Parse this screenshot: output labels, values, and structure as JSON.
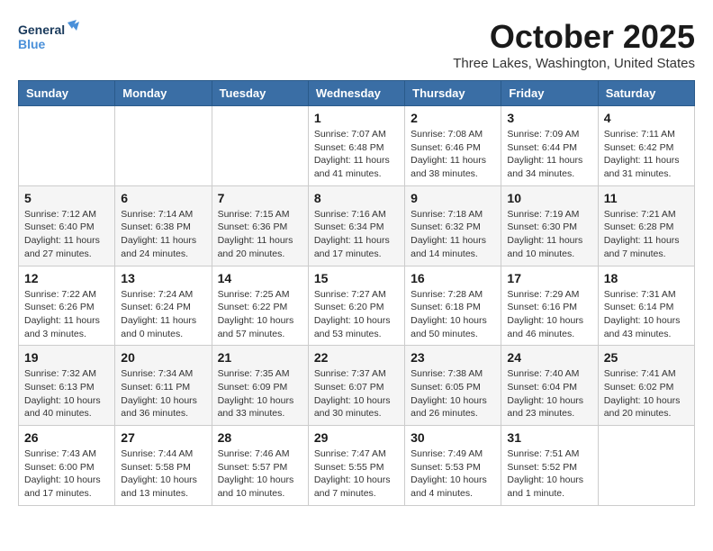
{
  "header": {
    "logo_general": "General",
    "logo_blue": "Blue",
    "month_title": "October 2025",
    "location": "Three Lakes, Washington, United States"
  },
  "weekdays": [
    "Sunday",
    "Monday",
    "Tuesday",
    "Wednesday",
    "Thursday",
    "Friday",
    "Saturday"
  ],
  "weeks": [
    [
      {
        "day": "",
        "info": ""
      },
      {
        "day": "",
        "info": ""
      },
      {
        "day": "",
        "info": ""
      },
      {
        "day": "1",
        "info": "Sunrise: 7:07 AM\nSunset: 6:48 PM\nDaylight: 11 hours and 41 minutes."
      },
      {
        "day": "2",
        "info": "Sunrise: 7:08 AM\nSunset: 6:46 PM\nDaylight: 11 hours and 38 minutes."
      },
      {
        "day": "3",
        "info": "Sunrise: 7:09 AM\nSunset: 6:44 PM\nDaylight: 11 hours and 34 minutes."
      },
      {
        "day": "4",
        "info": "Sunrise: 7:11 AM\nSunset: 6:42 PM\nDaylight: 11 hours and 31 minutes."
      }
    ],
    [
      {
        "day": "5",
        "info": "Sunrise: 7:12 AM\nSunset: 6:40 PM\nDaylight: 11 hours and 27 minutes."
      },
      {
        "day": "6",
        "info": "Sunrise: 7:14 AM\nSunset: 6:38 PM\nDaylight: 11 hours and 24 minutes."
      },
      {
        "day": "7",
        "info": "Sunrise: 7:15 AM\nSunset: 6:36 PM\nDaylight: 11 hours and 20 minutes."
      },
      {
        "day": "8",
        "info": "Sunrise: 7:16 AM\nSunset: 6:34 PM\nDaylight: 11 hours and 17 minutes."
      },
      {
        "day": "9",
        "info": "Sunrise: 7:18 AM\nSunset: 6:32 PM\nDaylight: 11 hours and 14 minutes."
      },
      {
        "day": "10",
        "info": "Sunrise: 7:19 AM\nSunset: 6:30 PM\nDaylight: 11 hours and 10 minutes."
      },
      {
        "day": "11",
        "info": "Sunrise: 7:21 AM\nSunset: 6:28 PM\nDaylight: 11 hours and 7 minutes."
      }
    ],
    [
      {
        "day": "12",
        "info": "Sunrise: 7:22 AM\nSunset: 6:26 PM\nDaylight: 11 hours and 3 minutes."
      },
      {
        "day": "13",
        "info": "Sunrise: 7:24 AM\nSunset: 6:24 PM\nDaylight: 11 hours and 0 minutes."
      },
      {
        "day": "14",
        "info": "Sunrise: 7:25 AM\nSunset: 6:22 PM\nDaylight: 10 hours and 57 minutes."
      },
      {
        "day": "15",
        "info": "Sunrise: 7:27 AM\nSunset: 6:20 PM\nDaylight: 10 hours and 53 minutes."
      },
      {
        "day": "16",
        "info": "Sunrise: 7:28 AM\nSunset: 6:18 PM\nDaylight: 10 hours and 50 minutes."
      },
      {
        "day": "17",
        "info": "Sunrise: 7:29 AM\nSunset: 6:16 PM\nDaylight: 10 hours and 46 minutes."
      },
      {
        "day": "18",
        "info": "Sunrise: 7:31 AM\nSunset: 6:14 PM\nDaylight: 10 hours and 43 minutes."
      }
    ],
    [
      {
        "day": "19",
        "info": "Sunrise: 7:32 AM\nSunset: 6:13 PM\nDaylight: 10 hours and 40 minutes."
      },
      {
        "day": "20",
        "info": "Sunrise: 7:34 AM\nSunset: 6:11 PM\nDaylight: 10 hours and 36 minutes."
      },
      {
        "day": "21",
        "info": "Sunrise: 7:35 AM\nSunset: 6:09 PM\nDaylight: 10 hours and 33 minutes."
      },
      {
        "day": "22",
        "info": "Sunrise: 7:37 AM\nSunset: 6:07 PM\nDaylight: 10 hours and 30 minutes."
      },
      {
        "day": "23",
        "info": "Sunrise: 7:38 AM\nSunset: 6:05 PM\nDaylight: 10 hours and 26 minutes."
      },
      {
        "day": "24",
        "info": "Sunrise: 7:40 AM\nSunset: 6:04 PM\nDaylight: 10 hours and 23 minutes."
      },
      {
        "day": "25",
        "info": "Sunrise: 7:41 AM\nSunset: 6:02 PM\nDaylight: 10 hours and 20 minutes."
      }
    ],
    [
      {
        "day": "26",
        "info": "Sunrise: 7:43 AM\nSunset: 6:00 PM\nDaylight: 10 hours and 17 minutes."
      },
      {
        "day": "27",
        "info": "Sunrise: 7:44 AM\nSunset: 5:58 PM\nDaylight: 10 hours and 13 minutes."
      },
      {
        "day": "28",
        "info": "Sunrise: 7:46 AM\nSunset: 5:57 PM\nDaylight: 10 hours and 10 minutes."
      },
      {
        "day": "29",
        "info": "Sunrise: 7:47 AM\nSunset: 5:55 PM\nDaylight: 10 hours and 7 minutes."
      },
      {
        "day": "30",
        "info": "Sunrise: 7:49 AM\nSunset: 5:53 PM\nDaylight: 10 hours and 4 minutes."
      },
      {
        "day": "31",
        "info": "Sunrise: 7:51 AM\nSunset: 5:52 PM\nDaylight: 10 hours and 1 minute."
      },
      {
        "day": "",
        "info": ""
      }
    ]
  ]
}
